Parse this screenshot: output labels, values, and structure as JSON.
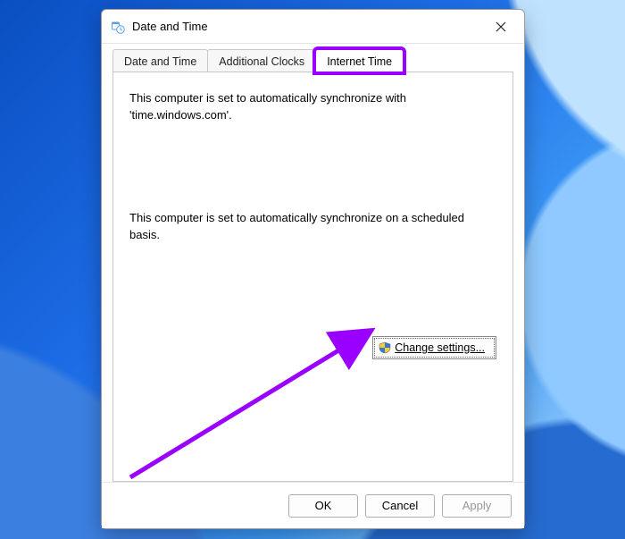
{
  "window": {
    "title": "Date and Time"
  },
  "tabs": {
    "date_time": "Date and Time",
    "additional_clocks": "Additional Clocks",
    "internet_time": "Internet Time"
  },
  "content": {
    "sync_server_line": "This computer is set to automatically synchronize with 'time.windows.com'.",
    "schedule_line": "This computer is set to automatically synchronize on a scheduled basis.",
    "change_settings": "Change settings..."
  },
  "footer": {
    "ok": "OK",
    "cancel": "Cancel",
    "apply": "Apply"
  }
}
